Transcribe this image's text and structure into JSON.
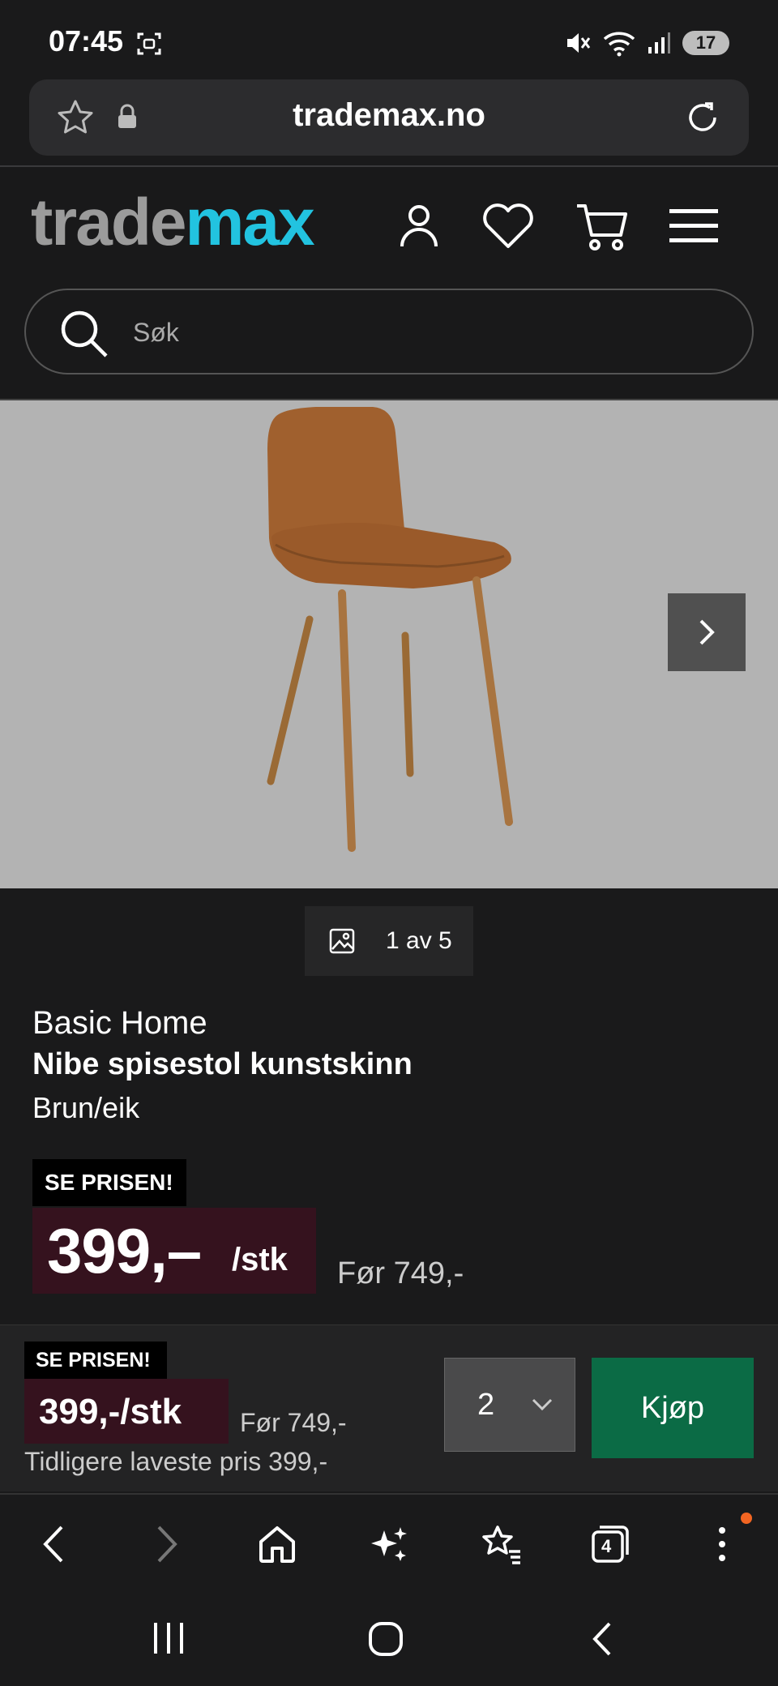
{
  "status_bar": {
    "time": "07:45",
    "battery": "17"
  },
  "browser": {
    "url": "trademax.no"
  },
  "site": {
    "logo_part1": "trade",
    "logo_part2": "max",
    "search_placeholder": "Søk"
  },
  "gallery": {
    "counter": "1 av 5"
  },
  "product": {
    "brand": "Basic Home",
    "name": "Nibe spisestol kunstskinn",
    "variant": "Brun/eik",
    "badge": "SE PRISEN!",
    "price": "399,–",
    "unit": "/stk",
    "before_price": "Før 749,-"
  },
  "buy_bar": {
    "badge": "SE PRISEN!",
    "price": "399,-/stk",
    "before_price": "Før 749,-",
    "lowest_price": "Tidligere laveste pris 399,-",
    "quantity": "2",
    "buy_label": "Kjøp"
  },
  "toolbar": {
    "tabs_count": "4"
  },
  "colors": {
    "brand_cyan": "#22c3e0",
    "price_bg": "#35121e",
    "buy_green": "#0b6b45"
  }
}
